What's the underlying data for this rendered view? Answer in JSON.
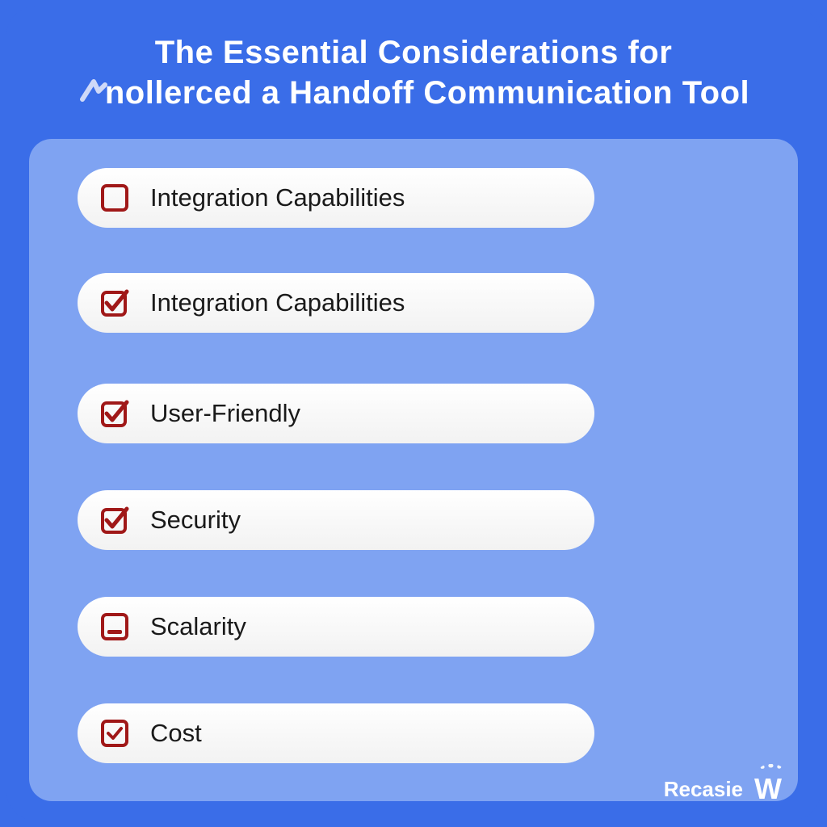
{
  "title_line1": "The Essential Considerations for",
  "title_line2": "nollerced a Handoff Communication Tool",
  "colors": {
    "background": "#3a6de8",
    "panel": "#7fa3f2",
    "check": "#a01818",
    "text": "#1a1a1a",
    "title_text": "#ffffff"
  },
  "items": [
    {
      "label": "Integration Capabilities",
      "state": "empty"
    },
    {
      "label": "Integration Capabilities",
      "state": "checked"
    },
    {
      "label": "User-Friendly",
      "state": "checked"
    },
    {
      "label": "Security",
      "state": "checked"
    },
    {
      "label": "Scalarity",
      "state": "minus"
    },
    {
      "label": "Cost",
      "state": "small-check"
    }
  ],
  "brand": "Recasie"
}
